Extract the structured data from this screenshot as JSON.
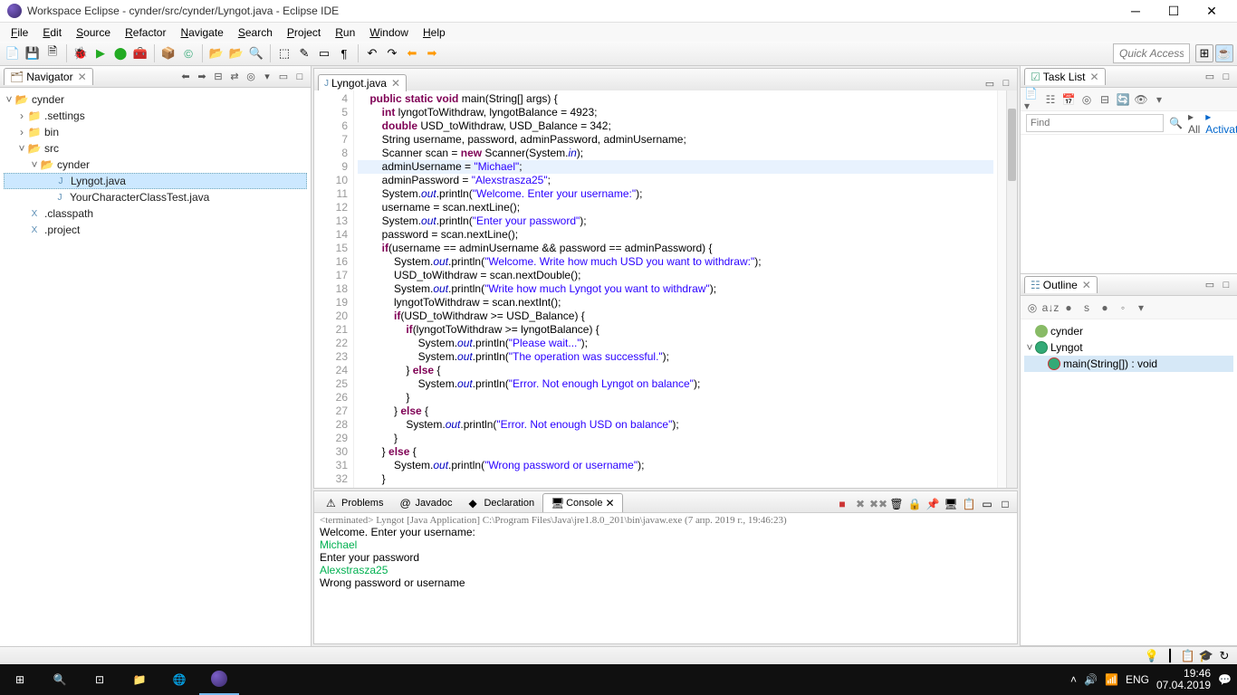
{
  "titlebar": {
    "title": "Workspace Eclipse - cynder/src/cynder/Lyngot.java - Eclipse IDE"
  },
  "menubar": [
    "File",
    "Edit",
    "Source",
    "Refactor",
    "Navigate",
    "Search",
    "Project",
    "Run",
    "Window",
    "Help"
  ],
  "quick_access": "Quick Access",
  "navigator": {
    "title": "Navigator",
    "project": "cynder",
    "items": [
      {
        "kind": "folder",
        "label": ".settings",
        "depth": 1
      },
      {
        "kind": "folder",
        "label": "bin",
        "depth": 1
      },
      {
        "kind": "folder-open",
        "label": "src",
        "depth": 1
      },
      {
        "kind": "folder-open",
        "label": "cynder",
        "depth": 2
      },
      {
        "kind": "java",
        "label": "Lyngot.java",
        "depth": 3,
        "selected": true
      },
      {
        "kind": "java",
        "label": "YourCharacterClassTest.java",
        "depth": 3
      },
      {
        "kind": "xml",
        "label": ".classpath",
        "depth": 1
      },
      {
        "kind": "xml",
        "label": ".project",
        "depth": 1
      }
    ]
  },
  "editor": {
    "tab": "Lyngot.java",
    "lines_start": 4,
    "lines_end": 32,
    "code": [
      {
        "n": 4,
        "html": "    <span class='kw'>public static void</span> main(String[] args) {"
      },
      {
        "n": 5,
        "html": "        <span class='kw'>int</span> lyngotToWithdraw, lyngotBalance = 4923;"
      },
      {
        "n": 6,
        "html": "        <span class='kw'>double</span> USD_toWithdraw, USD_Balance = 342;"
      },
      {
        "n": 7,
        "html": "        String username, password, adminPassword, adminUsername;"
      },
      {
        "n": 8,
        "html": "        Scanner scan = <span class='kw'>new</span> Scanner(System.<span class='fld'>in</span>);"
      },
      {
        "n": 9,
        "html": "        adminUsername = <span class='str'>\"Michael\"</span>;",
        "hl": true
      },
      {
        "n": 10,
        "html": "        adminPassword = <span class='str'>\"Alexstrasza25\"</span>;"
      },
      {
        "n": 11,
        "html": "        System.<span class='fld'>out</span>.println(<span class='str'>\"Welcome. Enter your username:\"</span>);"
      },
      {
        "n": 12,
        "html": "        username = scan.nextLine();"
      },
      {
        "n": 13,
        "html": "        System.<span class='fld'>out</span>.println(<span class='str'>\"Enter your password\"</span>);"
      },
      {
        "n": 14,
        "html": "        password = scan.nextLine();"
      },
      {
        "n": 15,
        "html": "        <span class='kw'>if</span>(username == adminUsername && password == adminPassword) {"
      },
      {
        "n": 16,
        "html": "            System.<span class='fld'>out</span>.println(<span class='str'>\"Welcome. Write how much USD you want to withdraw:\"</span>);"
      },
      {
        "n": 17,
        "html": "            USD_toWithdraw = scan.nextDouble();"
      },
      {
        "n": 18,
        "html": "            System.<span class='fld'>out</span>.println(<span class='str'>\"Write how much Lyngot you want to withdraw\"</span>);"
      },
      {
        "n": 19,
        "html": "            lyngotToWithdraw = scan.nextInt();"
      },
      {
        "n": 20,
        "html": "            <span class='kw'>if</span>(USD_toWithdraw >= USD_Balance) {"
      },
      {
        "n": 21,
        "html": "                <span class='kw'>if</span>(lyngotToWithdraw >= lyngotBalance) {"
      },
      {
        "n": 22,
        "html": "                    System.<span class='fld'>out</span>.println(<span class='str'>\"Please wait...\"</span>);"
      },
      {
        "n": 23,
        "html": "                    System.<span class='fld'>out</span>.println(<span class='str'>\"The operation was successful.\"</span>);"
      },
      {
        "n": 24,
        "html": "                } <span class='kw'>else</span> {"
      },
      {
        "n": 25,
        "html": "                    System.<span class='fld'>out</span>.println(<span class='str'>\"Error. Not enough Lyngot on balance\"</span>);"
      },
      {
        "n": 26,
        "html": "                }"
      },
      {
        "n": 27,
        "html": "            } <span class='kw'>else</span> {"
      },
      {
        "n": 28,
        "html": "                System.<span class='fld'>out</span>.println(<span class='str'>\"Error. Not enough USD on balance\"</span>);"
      },
      {
        "n": 29,
        "html": "            }"
      },
      {
        "n": 30,
        "html": "        } <span class='kw'>else</span> {"
      },
      {
        "n": 31,
        "html": "            System.<span class='fld'>out</span>.println(<span class='str'>\"Wrong password or username\"</span>);"
      },
      {
        "n": 32,
        "html": "        }"
      }
    ]
  },
  "bottom": {
    "tabs": [
      "Problems",
      "Javadoc",
      "Declaration",
      "Console"
    ],
    "active": 3,
    "console_meta": "<terminated> Lyngot [Java Application] C:\\Program Files\\Java\\jre1.8.0_201\\bin\\javaw.exe (7 апр. 2019 г., 19:46:23)",
    "lines": [
      {
        "cls": "out",
        "text": "Welcome. Enter your username:"
      },
      {
        "cls": "in",
        "text": "Michael"
      },
      {
        "cls": "out",
        "text": "Enter your password"
      },
      {
        "cls": "in",
        "text": "Alexstrasza25"
      },
      {
        "cls": "out",
        "text": "Wrong password or username"
      }
    ]
  },
  "tasklist": {
    "title": "Task List",
    "find": "Find",
    "all": "All",
    "activate": "Activate..."
  },
  "outline": {
    "title": "Outline",
    "package": "cynder",
    "class": "Lyngot",
    "method": "main(String[]) : void"
  },
  "tray": {
    "lang": "ENG",
    "time": "19:46",
    "date": "07.04.2019"
  }
}
